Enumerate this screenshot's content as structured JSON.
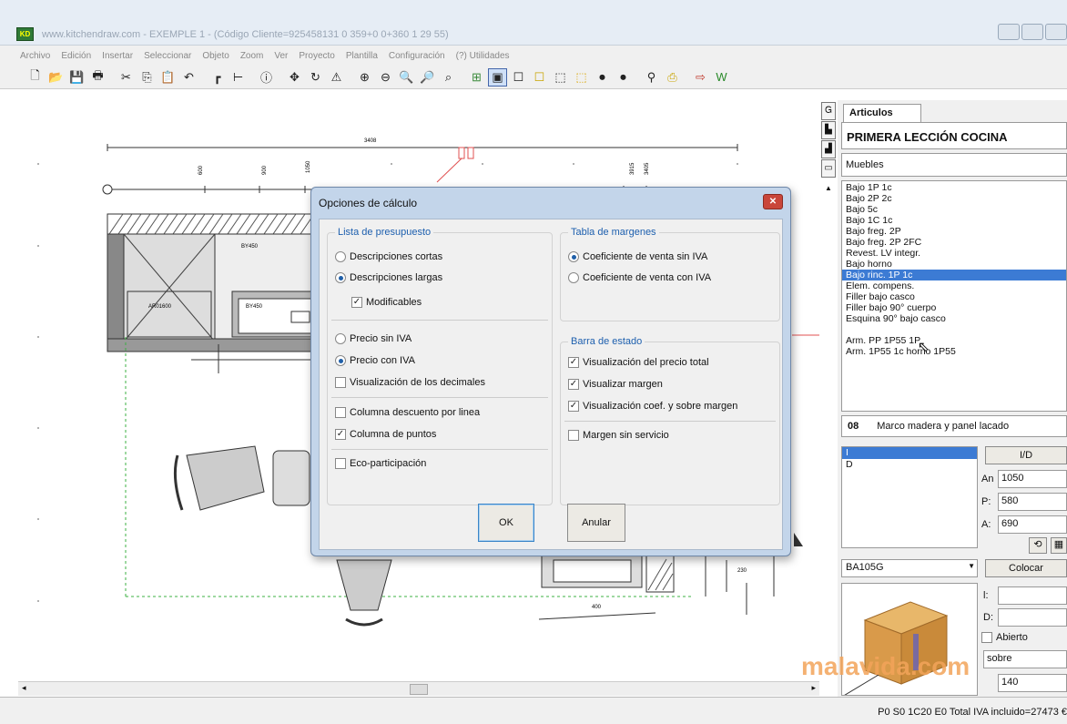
{
  "window": {
    "title": "www.kitchendraw.com - EXEMPLE 1 - (Código Cliente=925458131 0 359+0 0+360 1 29 55)"
  },
  "menu": [
    "Archivo",
    "Edición",
    "Insertar",
    "Seleccionar",
    "Objeto",
    "Zoom",
    "Ver",
    "Proyecto",
    "Plantilla",
    "Configuración",
    "(?) Utilidades"
  ],
  "plan": {
    "dims": {
      "total": "3408",
      "d1": "600",
      "d2": "900",
      "d3": "1050",
      "d4": "3915",
      "d5": "3405",
      "d6": "400",
      "d7": "230"
    },
    "labels": {
      "a1": "AR01600",
      "a2": "BY450",
      "a3": "BY450"
    }
  },
  "dialog": {
    "title": "Opciones de cálculo",
    "close": "✕",
    "group1": {
      "title": "Lista de presupuesto",
      "desc_cortas": "Descripciones cortas",
      "desc_largas": "Descripciones largas",
      "modificables": "Modificables",
      "precio_sin": "Precio sin IVA",
      "precio_con": "Precio con IVA",
      "decimales": "Visualización de los decimales",
      "descuento": "Columna descuento por linea",
      "puntos": "Columna de puntos",
      "eco": "Eco-participación"
    },
    "group2": {
      "title": "Tabla de margenes",
      "sin_iva": "Coeficiente de venta sin IVA",
      "con_iva": "Coeficiente de venta con IVA"
    },
    "group3": {
      "title": "Barra de estado",
      "precio_total": "Visualización del precio total",
      "margen": "Visualizar margen",
      "coef": "Visualización coef. y sobre margen",
      "sin_servicio": "Margen sin servicio"
    },
    "ok": "OK",
    "cancel": "Anular"
  },
  "panel": {
    "tab": "Articulos",
    "catalog": "PRIMERA LECCIÓN COCINA",
    "category": "Muebles",
    "items": [
      "Bajo 1P 1c",
      "Bajo 2P 2c",
      "Bajo 5c",
      "Bajo 1C 1c",
      "Bajo freg. 2P",
      "Bajo freg. 2P 2FC",
      "Revest. LV integr.",
      "Bajo horno",
      "Bajo rinc. 1P 1c",
      "Elem. compens.",
      "Filler bajo casco",
      "Filler bajo 90° cuerpo",
      "Esquina 90° bajo casco",
      "",
      "Arm. PP 1P55 1P",
      "Arm. 1P55 1c horno 1P55"
    ],
    "selected_index": 8,
    "finish_code": "08",
    "finish_name": "Marco madera y panel lacado",
    "hinge_options": [
      "I",
      "D"
    ],
    "id_button": "I/D",
    "an_label": "An",
    "an_value": "1050",
    "p_label": "P:",
    "p_value": "580",
    "a_label": "A:",
    "a_value": "690",
    "ref": "BA105G",
    "place_button": "Colocar",
    "l_label": "l:",
    "d_label": "D:",
    "abierto": "Abierto",
    "sobre": "sobre",
    "sobre_value": "140"
  },
  "status": "P0 S0 1C20 E0 Total IVA incluido=27473 €",
  "watermark": "malavida.com"
}
